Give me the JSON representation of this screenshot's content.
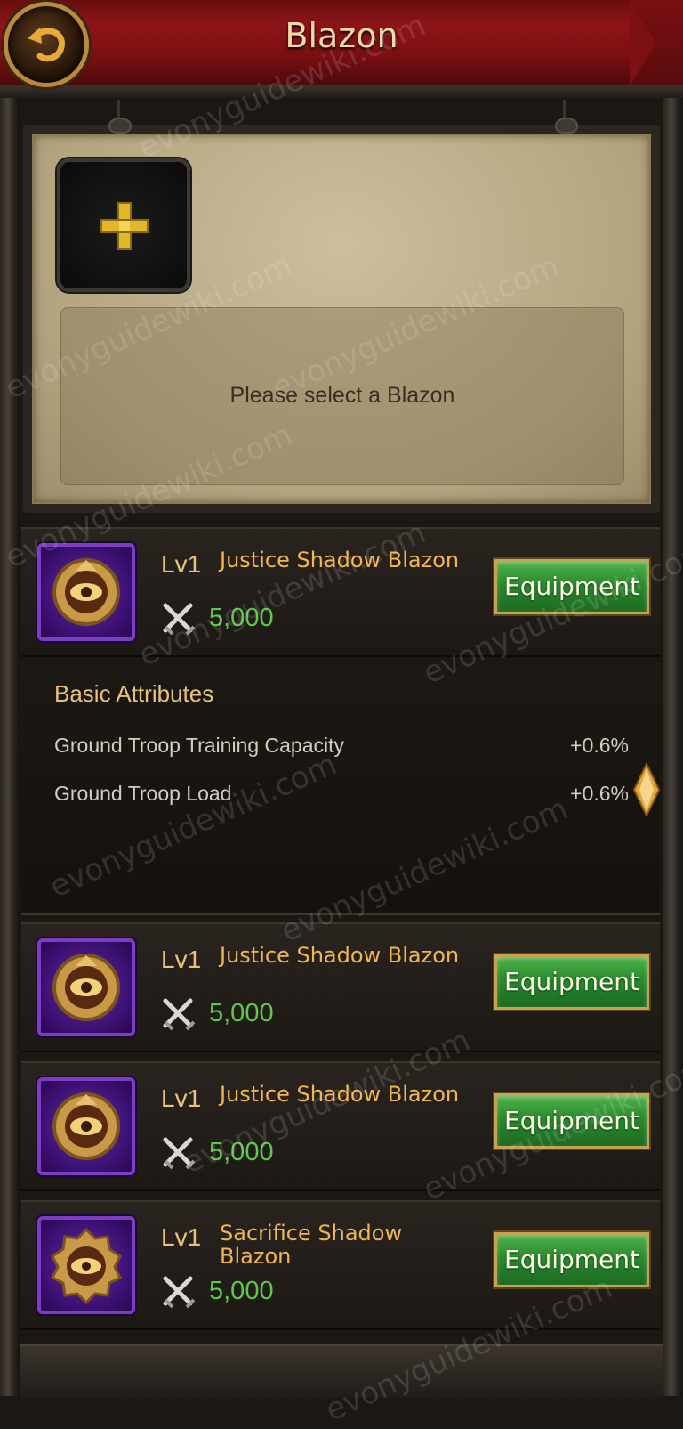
{
  "header": {
    "title": "Blazon"
  },
  "selection": {
    "hint": "Please select a Blazon"
  },
  "blazons": [
    {
      "level": "Lv1",
      "name": "Justice Shadow Blazon",
      "power": "5,000",
      "action": "Equipment"
    },
    {
      "level": "Lv1",
      "name": "Justice Shadow Blazon",
      "power": "5,000",
      "action": "Equipment"
    },
    {
      "level": "Lv1",
      "name": "Justice Shadow Blazon",
      "power": "5,000",
      "action": "Equipment"
    },
    {
      "level": "Lv1",
      "name": "Sacrifice Shadow Blazon",
      "power": "5,000",
      "action": "Equipment"
    }
  ],
  "attributes": {
    "title": "Basic Attributes",
    "items": [
      {
        "label": "Ground Troop Training Capacity",
        "value": "+0.6%"
      },
      {
        "label": "Ground Troop Load",
        "value": "+0.6%"
      }
    ]
  },
  "watermarks": [
    "evonyguidewiki.com",
    "evonyguidewiki.com",
    "evonyguidewiki.com",
    "evonyguidewiki.com",
    "evonyguidewiki.com",
    "evonyguidewiki.com",
    "evonyguidewiki.com",
    "evonyguidewiki.com",
    "evonyguidewiki.com",
    "evonyguidewiki.com",
    "evonyguidewiki.com"
  ],
  "icons": {
    "back": "back-arrow-icon",
    "add": "plus-icon",
    "blazon": "eye-emblem-icon",
    "power": "crossed-swords-icon",
    "expand": "diamond-gem-icon"
  },
  "colors": {
    "header": "#8e1418",
    "title": "#f0d9a8",
    "name": "#f2b64e",
    "power": "#5ec84a",
    "button": "#2a8a2f",
    "icon_frame": "#7c3cc4"
  }
}
